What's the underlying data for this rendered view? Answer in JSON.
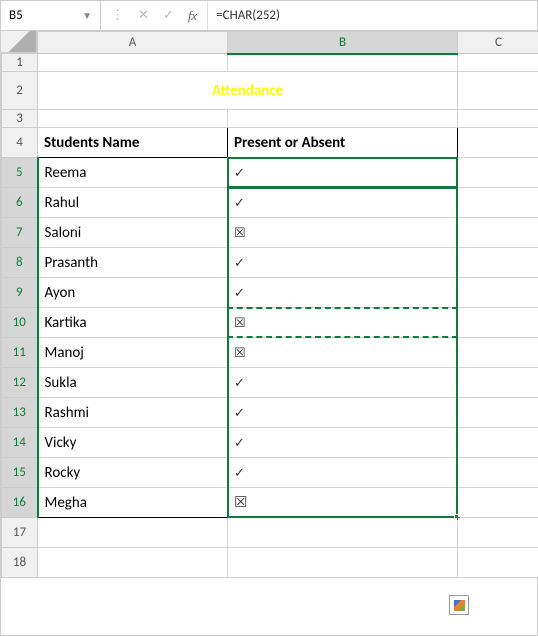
{
  "nameBox": "B5",
  "formula": "=CHAR(252)",
  "columns": [
    "A",
    "B",
    "C"
  ],
  "title": "Attendance",
  "headers": {
    "a": "Students Name",
    "b": "Present or Absent"
  },
  "rows": [
    {
      "n": 5,
      "name": "Reema",
      "mark": "✓"
    },
    {
      "n": 6,
      "name": "Rahul",
      "mark": "✓"
    },
    {
      "n": 7,
      "name": "Saloni",
      "mark": "☒"
    },
    {
      "n": 8,
      "name": "Prasanth",
      "mark": "✓"
    },
    {
      "n": 9,
      "name": "Ayon",
      "mark": "✓"
    },
    {
      "n": 10,
      "name": "Kartika",
      "mark": "☒"
    },
    {
      "n": 11,
      "name": "Manoj",
      "mark": "☒"
    },
    {
      "n": 12,
      "name": "Sukla",
      "mark": "✓"
    },
    {
      "n": 13,
      "name": "Rashmi",
      "mark": "✓"
    },
    {
      "n": 14,
      "name": "Vicky",
      "mark": "✓"
    },
    {
      "n": 15,
      "name": "Rocky",
      "mark": "✓"
    },
    {
      "n": 16,
      "name": "Megha",
      "mark": "☒"
    }
  ],
  "emptyRows": [
    17,
    18
  ]
}
